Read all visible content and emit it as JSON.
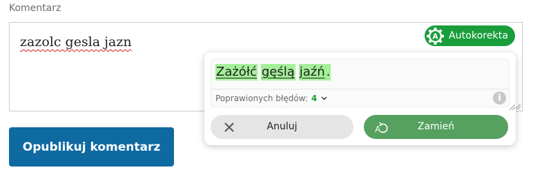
{
  "comment": {
    "label": "Komentarz",
    "text": "zazolc gesla jazn"
  },
  "publish_button": "Opublikuj komentarz",
  "autocorrect": {
    "badge_label": "Autokorekta",
    "badge_icon": "gear-a-icon",
    "corrected_words": [
      "Zażółć",
      "gęślą",
      "jaźń"
    ],
    "trailing_punctuation": ".",
    "stats_label": "Poprawionych błędów:",
    "stats_count": "4",
    "cancel_label": "Anuluj",
    "replace_label": "Zamień",
    "colors": {
      "badge": "#1a9e3c",
      "replace": "#56a060",
      "highlight": "#a4ef9a",
      "publish": "#0f6aa1"
    }
  }
}
